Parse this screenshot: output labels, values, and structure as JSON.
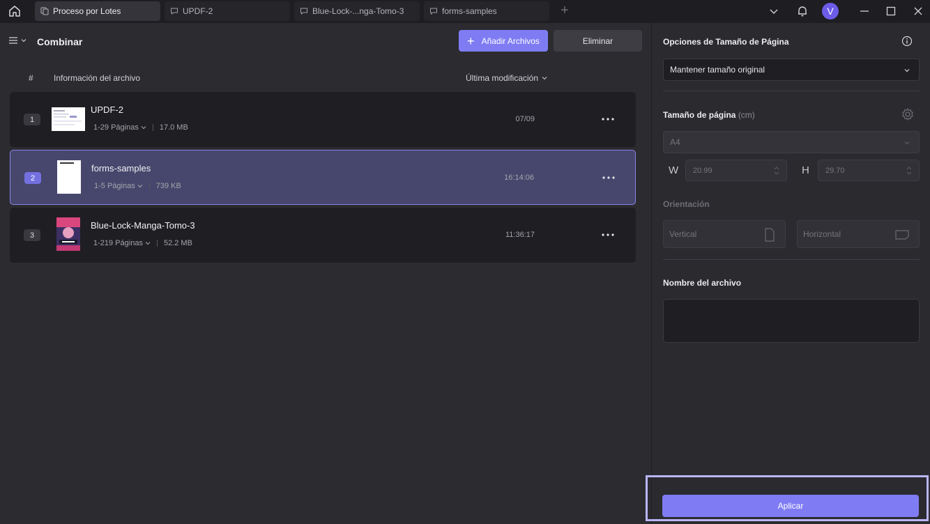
{
  "titlebar": {
    "tabs": [
      {
        "label": "Proceso por Lotes",
        "active": true
      },
      {
        "label": "UPDF-2",
        "active": false
      },
      {
        "label": "Blue-Lock-...nga-Tomo-3",
        "active": false
      },
      {
        "label": "forms-samples",
        "active": false
      }
    ],
    "avatar_initial": "V"
  },
  "toolbar": {
    "title": "Combinar",
    "add_files_label": "Añadir Archivos",
    "delete_label": "Eliminar"
  },
  "table": {
    "col_number": "#",
    "col_info": "Información del archivo",
    "col_modified": "Última modificación",
    "rows": [
      {
        "index": "1",
        "name": "UPDF-2",
        "pages": "1-29 Páginas",
        "size": "17.0 MB",
        "date": "07/09",
        "selected": false
      },
      {
        "index": "2",
        "name": "forms-samples",
        "pages": "1-5 Páginas",
        "size": "739 KB",
        "date": "16:14:06",
        "selected": true
      },
      {
        "index": "3",
        "name": "Blue-Lock-Manga-Tomo-3",
        "pages": "1-219 Páginas",
        "size": "52.2 MB",
        "date": "11:36:17",
        "selected": false
      }
    ]
  },
  "panel": {
    "page_size_options_title": "Opciones de Tamaño de Página",
    "page_size_option_value": "Mantener tamaño original",
    "page_size_title": "Tamaño de página",
    "page_size_unit": "(cm)",
    "paper_value": "A4",
    "width_label": "W",
    "width_value": "20.99",
    "height_label": "H",
    "height_value": "29.70",
    "orientation_title": "Orientación",
    "orientation_vertical": "Vertical",
    "orientation_horizontal": "Horizontal",
    "filename_title": "Nombre del archivo",
    "apply_label": "Aplicar"
  },
  "colors": {
    "accent": "#7f7cf3",
    "selected_row": "#47476d",
    "highlight_frame": "#b9b6f7"
  }
}
